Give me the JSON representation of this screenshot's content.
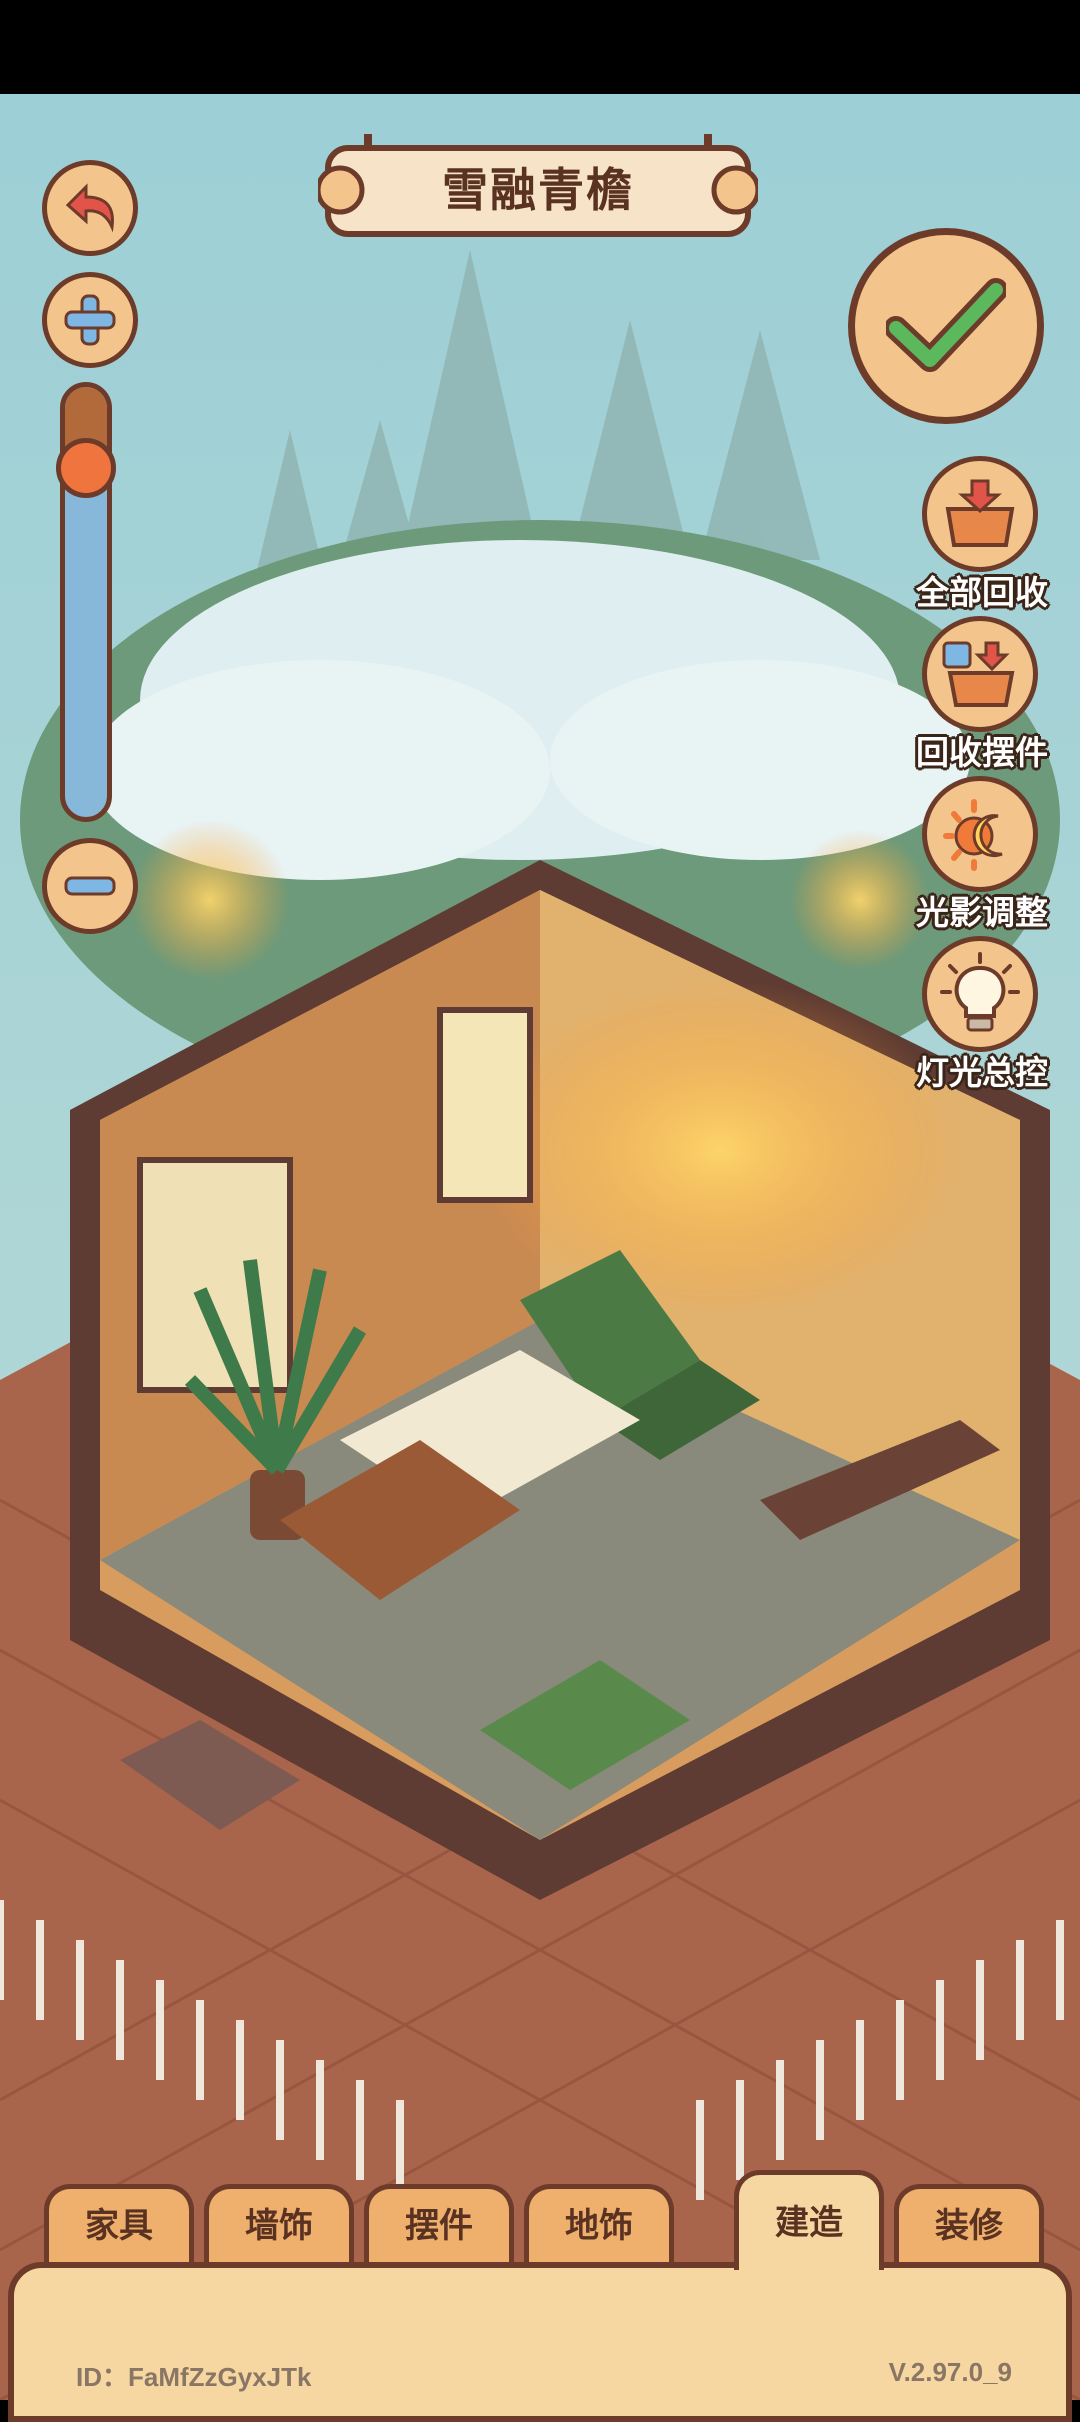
{
  "room": {
    "title": "雪融青檐"
  },
  "toolbar": {
    "undo_icon": "undo-arrow-icon",
    "zoom_in_icon": "plus-icon",
    "zoom_out_icon": "minus-icon",
    "zoom_level": 0.18,
    "confirm_icon": "checkmark-icon"
  },
  "side_actions": [
    {
      "label": "全部回收",
      "icon": "box-recall-icon"
    },
    {
      "label": "回收摆件",
      "icon": "cup-box-recall-icon"
    },
    {
      "label": "光影调整",
      "icon": "sun-moon-icon"
    },
    {
      "label": "灯光总控",
      "icon": "lightbulb-icon"
    }
  ],
  "tabs": [
    {
      "label": "家具",
      "active": false
    },
    {
      "label": "墙饰",
      "active": false
    },
    {
      "label": "摆件",
      "active": false
    },
    {
      "label": "地饰",
      "active": false
    },
    {
      "label": "建造",
      "active": true
    },
    {
      "label": "装修",
      "active": false
    }
  ],
  "footer": {
    "user_id": "ID：FaMfZzGyxJTk",
    "version": "V.2.97.0_9"
  },
  "colors": {
    "accent": "#f3c48b",
    "outline": "#6d3b2a",
    "panel": "#f7d7a1",
    "check": "#5cb85c"
  }
}
